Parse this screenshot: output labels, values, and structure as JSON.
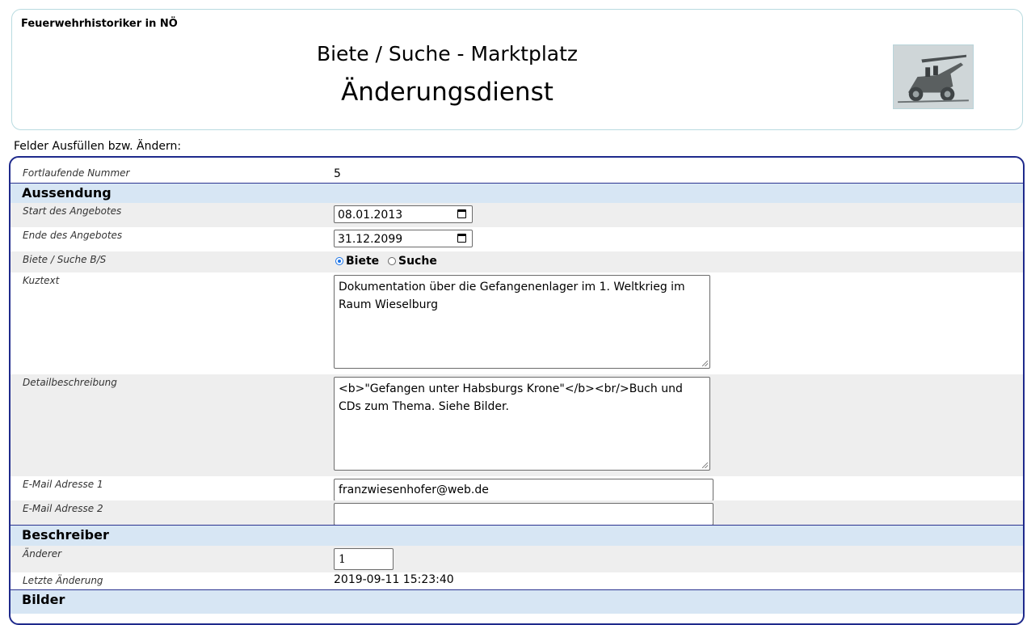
{
  "header": {
    "org": "Feuerwehrhistoriker in NÖ",
    "title": "Biete / Suche - Marktplatz",
    "subtitle": "Änderungsdienst"
  },
  "instructions": "Felder Ausfüllen bzw. Ändern:",
  "colors": {
    "section_bg": "#d7e6f4",
    "form_border": "#1f2a8c",
    "row_grey": "#eeeeee"
  },
  "form": {
    "number": {
      "label": "Fortlaufende Nummer",
      "value": "5"
    },
    "section_aussendung": "Aussendung",
    "start": {
      "label": "Start des Angebotes",
      "value": "08.01.2013"
    },
    "end": {
      "label": "Ende des Angebotes",
      "value": "31.12.2099"
    },
    "type": {
      "label": "Biete / Suche B/S",
      "option_biete": "Biete",
      "option_suche": "Suche",
      "selected": "Biete"
    },
    "shorttext": {
      "label": "Kuztext",
      "value": "Dokumentation über die Gefangenenlager im 1. Weltkrieg im Raum Wieselburg"
    },
    "detail": {
      "label": "Detailbeschreibung",
      "value": "<b>\"Gefangen unter Habsburgs Krone\"</b><br/>Buch und CDs zum Thema. Siehe Bilder."
    },
    "email1": {
      "label": "E-Mail Adresse 1",
      "value": "franzwiesenhofer@web.de"
    },
    "email2": {
      "label": "E-Mail Adresse 2",
      "value": ""
    },
    "section_beschreiber": "Beschreiber",
    "changer": {
      "label": "Änderer",
      "value": "1"
    },
    "last_change": {
      "label": "Letzte Änderung",
      "value": "2019-09-11 15:23:40"
    },
    "section_bilder": "Bilder"
  }
}
